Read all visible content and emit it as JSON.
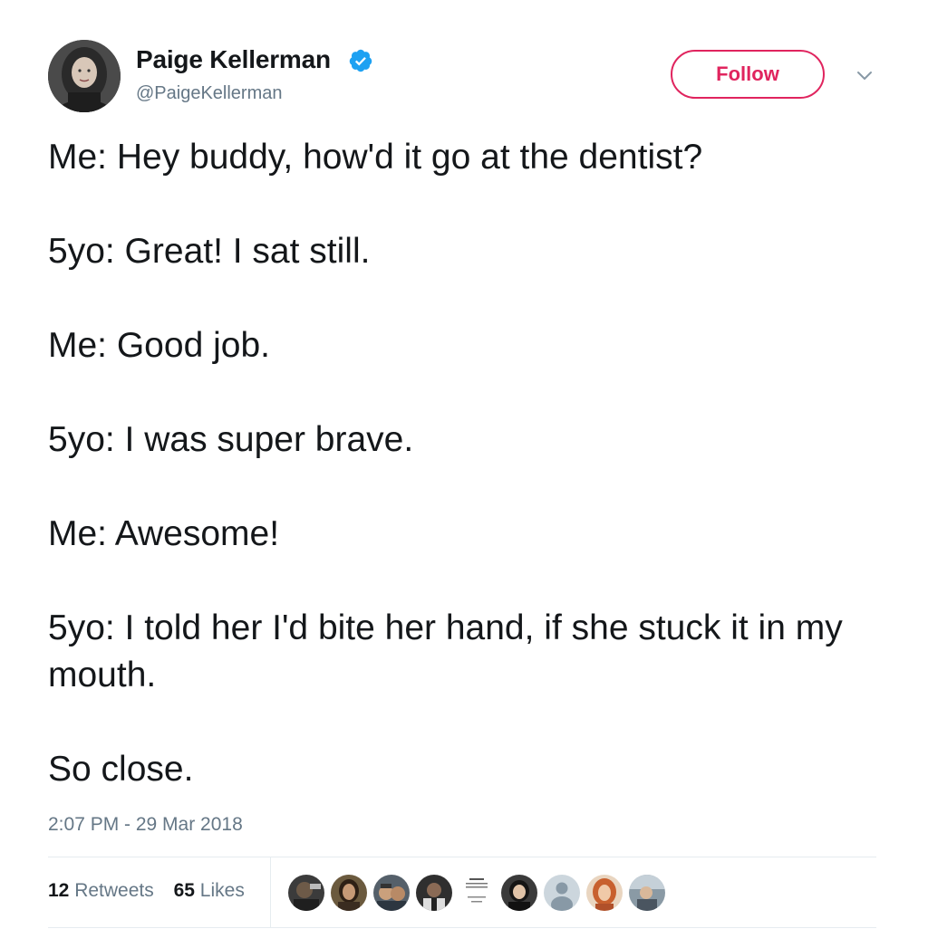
{
  "author": {
    "display_name": "Paige Kellerman",
    "handle": "@PaigeKellerman",
    "verified": true,
    "avatar_icon": "profile-photo"
  },
  "follow_button": {
    "label": "Follow",
    "color": "#e0245e"
  },
  "menu_icon": "chevron-down-icon",
  "tweet": {
    "lines": [
      "Me: Hey buddy, how'd it go at the dentist?",
      "5yo: Great! I sat still.",
      "Me: Good job.",
      "5yo: I was super brave.",
      "Me: Awesome!",
      "5yo: I told her I'd bite her hand, if she stuck it in my mouth.",
      "So close."
    ]
  },
  "timestamp": "2:07 PM - 29 Mar 2018",
  "stats": {
    "retweets_count": "12",
    "retweets_label": "Retweets",
    "likes_count": "65",
    "likes_label": "Likes"
  },
  "likers": [
    {
      "icon": "liker-avatar-1",
      "color": "#3b3b3b"
    },
    {
      "icon": "liker-avatar-2",
      "color": "#6b5a3e"
    },
    {
      "icon": "liker-avatar-3",
      "color": "#55606a"
    },
    {
      "icon": "liker-avatar-4",
      "color": "#2f2f2f"
    },
    {
      "icon": "liker-avatar-5",
      "color": "#ffffff"
    },
    {
      "icon": "liker-avatar-6",
      "color": "#3a3a3a"
    },
    {
      "icon": "default-avatar-icon",
      "color": "#ccd6dd"
    },
    {
      "icon": "liker-avatar-8",
      "color": "#c8602e"
    },
    {
      "icon": "liker-avatar-9",
      "color": "#8a9aa5"
    }
  ],
  "colors": {
    "text": "#14171a",
    "secondary_text": "#657786",
    "verified_blue": "#1da1f2",
    "divider": "#e6ecf0"
  }
}
